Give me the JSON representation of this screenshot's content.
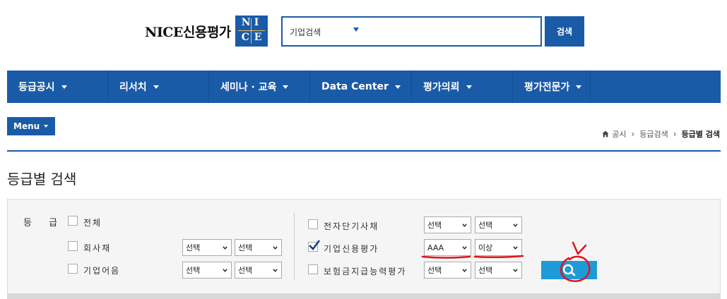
{
  "header": {
    "logo_text": "NICE신용평가",
    "logo_letters": [
      "N",
      "I",
      "C",
      "E"
    ],
    "search_type": "기업검색",
    "search_value": "",
    "search_button": "검색"
  },
  "nav": {
    "items": [
      {
        "label": "등급공시"
      },
      {
        "label": "리서치"
      },
      {
        "label": "세미나 · 교육"
      },
      {
        "label": "Data Center"
      },
      {
        "label": "평가의뢰"
      },
      {
        "label": "평가전문가"
      }
    ]
  },
  "menu_button": "Menu",
  "breadcrumb": {
    "home": "공시",
    "level2": "등급검색",
    "current": "등급별 검색"
  },
  "page_title": "등급별 검색",
  "filter": {
    "grade_label": "등 급",
    "left_options": [
      {
        "label": "전체",
        "checked": false
      },
      {
        "label": "회사채",
        "checked": false,
        "from": "선택",
        "to": "선택"
      },
      {
        "label": "기업어음",
        "checked": false,
        "from": "선택",
        "to": "선택"
      }
    ],
    "right_options": [
      {
        "label": "전자단기사채",
        "checked": false,
        "from": "선택",
        "to": "선택"
      },
      {
        "label": "기업신용평가",
        "checked": true,
        "from": "AAA",
        "to": "이상"
      },
      {
        "label": "보험금지급능력평가",
        "checked": false,
        "from": "선택",
        "to": "선택"
      }
    ]
  },
  "colors": {
    "brand": "#1a5ba8",
    "search_button": "#1e9ad8",
    "annotation": "#e0141e"
  }
}
